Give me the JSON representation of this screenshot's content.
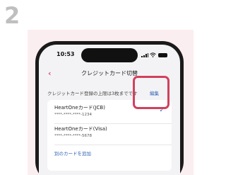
{
  "step_number": "2",
  "status_bar": {
    "time": "10:53"
  },
  "nav": {
    "title": "クレジットカード切替"
  },
  "info": {
    "limit_text": "クレジットカード登録の上限は3枚までです",
    "edit_label": "編集"
  },
  "cards": [
    {
      "name": "HeartOneカード(JCB)",
      "number": "****-****-****-1234",
      "selected": true
    },
    {
      "name": "HeartOneカード(Visa)",
      "number": "****-****-****-5678",
      "selected": false
    }
  ],
  "add_card_label": "別のカードを追加",
  "colors": {
    "accent": "#d4506d",
    "link": "#2f62b5",
    "highlight": "#d3405c",
    "background": "#fbeef0"
  },
  "icons": [
    "back-chevron-icon",
    "signal-icon",
    "wifi-icon",
    "battery-icon",
    "checkmark-icon"
  ]
}
